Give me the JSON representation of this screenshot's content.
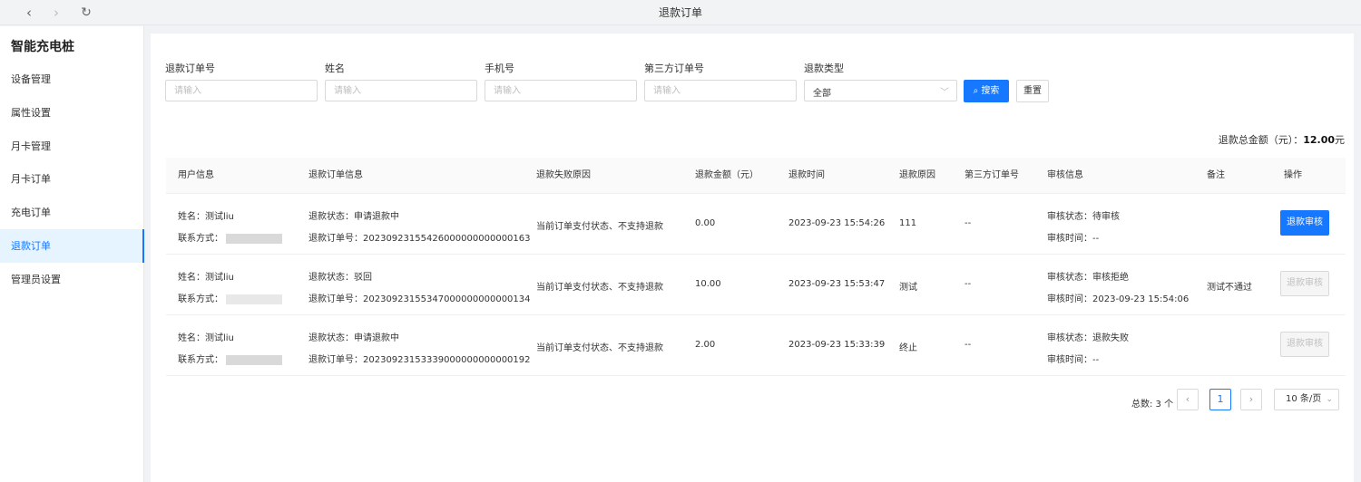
{
  "topbar": {
    "title": "退款订单",
    "back_icon": "‹",
    "forward_icon": "›",
    "refresh_icon": "↻"
  },
  "sidebar": {
    "app_title": "智能充电桩",
    "items": [
      {
        "label": "设备管理"
      },
      {
        "label": "属性设置"
      },
      {
        "label": "月卡管理"
      },
      {
        "label": "月卡订单"
      },
      {
        "label": "充电订单"
      },
      {
        "label": "退款订单"
      },
      {
        "label": "管理员设置"
      }
    ],
    "active_index": 5
  },
  "filters": {
    "refund_no": {
      "label": "退款订单号",
      "placeholder": "请输入",
      "value": ""
    },
    "name": {
      "label": "姓名",
      "placeholder": "请输入",
      "value": ""
    },
    "phone": {
      "label": "手机号",
      "placeholder": "请输入",
      "value": ""
    },
    "third_no": {
      "label": "第三方订单号",
      "placeholder": "请输入",
      "value": ""
    },
    "refund_type": {
      "label": "退款类型",
      "value": "全部"
    },
    "search_label": "搜索",
    "search_icon": "⌕",
    "reset_label": "重置"
  },
  "summary": {
    "label": "退款总金额（元）：",
    "amount": "12.00",
    "unit": "元"
  },
  "table": {
    "headers": [
      "用户信息",
      "退款订单信息",
      "退款失败原因",
      "退款金额（元）",
      "退款时间",
      "退款原因",
      "第三方订单号",
      "审核信息",
      "备注",
      "操作"
    ],
    "rows": [
      {
        "name": "姓名：测试liu",
        "contact": "联系方式：",
        "status": "退款状态：申请退款中",
        "order_no": "退款订单号：20230923155426000000000000163",
        "fail_reason": "当前订单支付状态、不支持退款",
        "amount": "0.00",
        "time": "2023-09-23 15:54:26",
        "reason": "111",
        "third_no": "--",
        "audit_status": "审核状态：待审核",
        "audit_time": "审核时间：--",
        "remark": "",
        "action": "退款审核",
        "action_enabled": true
      },
      {
        "name": "姓名：测试liu",
        "contact": "联系方式：",
        "status": "退款状态：驳回",
        "order_no": "退款订单号：20230923155347000000000000134",
        "fail_reason": "当前订单支付状态、不支持退款",
        "amount": "10.00",
        "time": "2023-09-23 15:53:47",
        "reason": "测试",
        "third_no": "--",
        "audit_status": "审核状态：审核拒绝",
        "audit_time": "审核时间：2023-09-23 15:54:06",
        "remark": "测试不通过",
        "action": "退款审核",
        "action_enabled": false
      },
      {
        "name": "姓名：测试liu",
        "contact": "联系方式：",
        "status": "退款状态：申请退款中",
        "order_no": "退款订单号：20230923153339000000000000192",
        "fail_reason": "当前订单支付状态、不支持退款",
        "amount": "2.00",
        "time": "2023-09-23 15:33:39",
        "reason": "终止",
        "third_no": "--",
        "audit_status": "审核状态：退款失败",
        "audit_time": "审核时间：--",
        "remark": "",
        "action": "退款审核",
        "action_enabled": false
      }
    ]
  },
  "pagination": {
    "total_label": "总数: 3 个",
    "prev_icon": "‹",
    "current_page": "1",
    "next_icon": "›",
    "page_size": "10 条/页",
    "size_arrow": "⌄"
  },
  "colors": {
    "primary": "#1677ff",
    "active_bg": "#e6f4ff"
  }
}
